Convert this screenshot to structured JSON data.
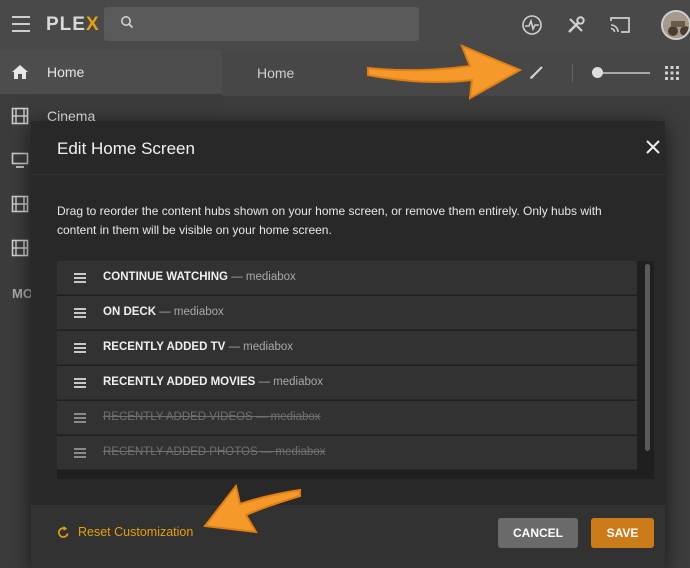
{
  "app": {
    "logo_text": "PLE",
    "logo_accent": "X",
    "accent_color": "#e5a00d"
  },
  "topbar": {
    "icons": [
      "activity-icon",
      "settings-icon",
      "cast-icon"
    ],
    "search_placeholder": ""
  },
  "sidebar": {
    "items": [
      {
        "label": "Home",
        "icon": "home-icon",
        "active": true
      },
      {
        "label": "Cinema",
        "icon": "film-icon",
        "active": false
      },
      {
        "label": "",
        "icon": "tv-icon",
        "active": false
      },
      {
        "label": "",
        "icon": "film-icon",
        "active": false
      },
      {
        "label": "",
        "icon": "film-icon",
        "active": false
      }
    ],
    "section_heading": "MO"
  },
  "main": {
    "title": "Home"
  },
  "modal": {
    "title": "Edit Home Screen",
    "description": "Drag to reorder the content hubs shown on your home screen, or remove them entirely. Only hubs with content in them will be visible on your home screen.",
    "hubs": [
      {
        "name": "CONTINUE WATCHING",
        "source": " — mediabox",
        "enabled": true
      },
      {
        "name": "ON DECK",
        "source": " — mediabox",
        "enabled": true
      },
      {
        "name": "RECENTLY ADDED TV",
        "source": " — mediabox",
        "enabled": true
      },
      {
        "name": "RECENTLY ADDED MOVIES",
        "source": " — mediabox",
        "enabled": true
      },
      {
        "name": "RECENTLY ADDED VIDEOS",
        "source": " — mediabox",
        "enabled": false
      },
      {
        "name": "RECENTLY ADDED PHOTOS",
        "source": " — mediabox",
        "enabled": false
      }
    ],
    "reset_label": "Reset Customization",
    "cancel_label": "CANCEL",
    "save_label": "SAVE"
  }
}
